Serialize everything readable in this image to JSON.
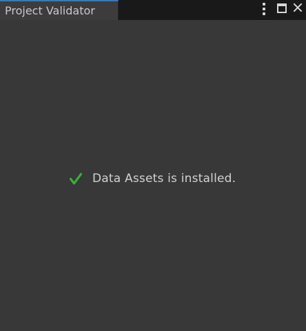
{
  "tab": {
    "title": "Project Validator"
  },
  "controls": {
    "menu_icon": "kebab-menu-icon",
    "maximize_icon": "maximize-icon",
    "close_icon": "close-icon"
  },
  "status": {
    "icon": "checkmark-icon",
    "icon_color": "#2fb52f",
    "message": "Data Assets is installed."
  },
  "colors": {
    "background": "#383838",
    "tabbar": "#191919",
    "tab_active": "#3c3c3c",
    "tab_accent": "#3a79bb"
  }
}
